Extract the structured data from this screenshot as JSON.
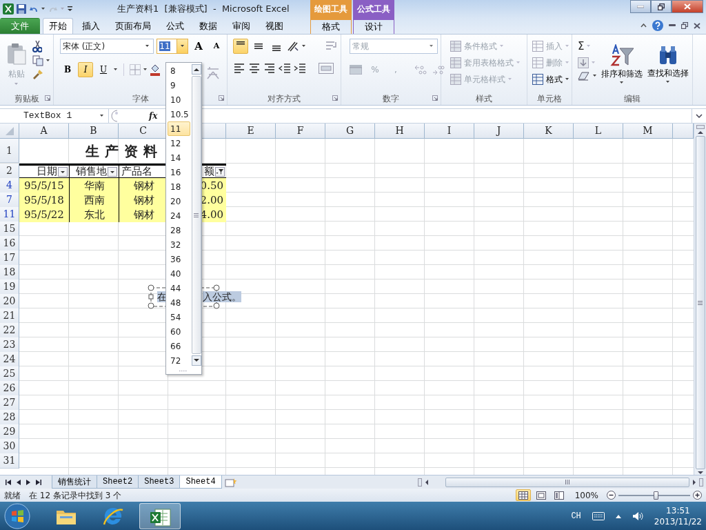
{
  "title_bar": {
    "title": "生产资料1  [兼容模式]  -  Microsoft Excel",
    "context_tabs": [
      {
        "label": "绘图工具",
        "color": "#e59a3c"
      },
      {
        "label": "公式工具",
        "color": "#8a5fc4"
      }
    ]
  },
  "tabs": [
    {
      "label": "文件",
      "kind": "file",
      "selected": false
    },
    {
      "label": "开始",
      "kind": "normal",
      "selected": true
    },
    {
      "label": "插入",
      "kind": "normal",
      "selected": false
    },
    {
      "label": "页面布局",
      "kind": "normal",
      "selected": false
    },
    {
      "label": "公式",
      "kind": "normal",
      "selected": false
    },
    {
      "label": "数据",
      "kind": "normal",
      "selected": false
    },
    {
      "label": "审阅",
      "kind": "normal",
      "selected": false
    },
    {
      "label": "视图",
      "kind": "normal",
      "selected": false
    },
    {
      "label": "格式",
      "kind": "context",
      "color": "#e59a3c",
      "selected": false
    },
    {
      "label": "设计",
      "kind": "context",
      "color": "#8a5fc4",
      "selected": false
    }
  ],
  "ribbon": {
    "clipboard": {
      "paste": "粘贴",
      "label": "剪贴板"
    },
    "font": {
      "name": "宋体 (正文)",
      "size": "11",
      "grow": "A",
      "shrink": "A",
      "bold": {
        "text": "B",
        "on": false
      },
      "italic": {
        "text": "I",
        "on": true
      },
      "underline": {
        "text": "U",
        "on": false
      },
      "label": "字体"
    },
    "alignment": {
      "vertical": [
        {
          "kind": "top",
          "selected": true
        },
        {
          "kind": "middle",
          "selected": false
        },
        {
          "kind": "bottom",
          "selected": false
        }
      ],
      "label": "对齐方式"
    },
    "number": {
      "format": "常规",
      "percent": "%",
      "comma": ",",
      "label": "数字"
    },
    "styles": {
      "items": [
        "条件格式",
        "套用表格格式",
        "单元格样式"
      ],
      "label": "样式"
    },
    "cells": {
      "items": [
        {
          "label": "插入",
          "disabled": true
        },
        {
          "label": "删除",
          "disabled": true
        },
        {
          "label": "格式",
          "disabled": false
        }
      ],
      "label": "单元格"
    },
    "editing": {
      "sum": "Σ",
      "sort": "排序和筛选",
      "find": "查找和选择",
      "label": "编辑"
    }
  },
  "formula_bar": {
    "name_box": "TextBox 1",
    "fx": "fx"
  },
  "sheet": {
    "columns": [
      {
        "label": "A",
        "kind": "normal"
      },
      {
        "label": "B",
        "kind": "normal"
      },
      {
        "label": "C",
        "kind": "normal"
      },
      {
        "kind": "covered"
      },
      {
        "label": "E",
        "kind": "normal"
      },
      {
        "label": "F",
        "kind": "normal"
      },
      {
        "label": "G",
        "kind": "normal"
      },
      {
        "label": "H",
        "kind": "normal"
      },
      {
        "label": "I",
        "kind": "normal"
      },
      {
        "label": "J",
        "kind": "normal"
      },
      {
        "label": "K",
        "kind": "normal"
      },
      {
        "label": "L",
        "kind": "normal"
      },
      {
        "label": "M",
        "kind": "normal"
      }
    ],
    "rows": [
      {
        "number": "1",
        "kind": "title",
        "filtered": false,
        "title": "生产资料"
      },
      {
        "number": "2",
        "kind": "header",
        "filtered": false,
        "cells": [
          {
            "text": "日期",
            "has_filter": true,
            "filter_applied": false
          },
          {
            "text": "销售地",
            "has_filter": true,
            "filter_applied": false
          },
          {
            "text": "产品名",
            "has_filter": false
          },
          {
            "text": "额",
            "has_filter": true,
            "filter_applied": true
          }
        ]
      },
      {
        "number": "4",
        "kind": "data",
        "filtered": true,
        "cells": [
          "95/5/15",
          "华南",
          "钢材",
          "0.50"
        ]
      },
      {
        "number": "7",
        "kind": "data",
        "filtered": true,
        "cells": [
          "95/5/18",
          "西南",
          "钢材",
          "2.00"
        ]
      },
      {
        "number": "11",
        "kind": "data",
        "filtered": true,
        "cells": [
          "95/5/22",
          "东北",
          "钢材",
          "4.00"
        ]
      },
      {
        "number": "15",
        "kind": "empty",
        "filtered": false
      },
      {
        "number": "16",
        "kind": "empty",
        "filtered": false
      },
      {
        "number": "17",
        "kind": "empty",
        "filtered": false
      },
      {
        "number": "18",
        "kind": "empty",
        "filtered": false
      },
      {
        "number": "19",
        "kind": "empty",
        "filtered": false
      },
      {
        "number": "20",
        "kind": "empty",
        "filtered": false
      },
      {
        "number": "21",
        "kind": "empty",
        "filtered": false
      },
      {
        "number": "22",
        "kind": "empty",
        "filtered": false
      },
      {
        "number": "23",
        "kind": "empty",
        "filtered": false
      },
      {
        "number": "24",
        "kind": "empty",
        "filtered": false
      },
      {
        "number": "25",
        "kind": "empty",
        "filtered": false
      },
      {
        "number": "26",
        "kind": "empty",
        "filtered": false
      },
      {
        "number": "27",
        "kind": "empty",
        "filtered": false
      },
      {
        "number": "28",
        "kind": "empty",
        "filtered": false
      },
      {
        "number": "29",
        "kind": "empty",
        "filtered": false
      },
      {
        "number": "30",
        "kind": "empty",
        "filtered": false
      },
      {
        "number": "31",
        "kind": "empty",
        "filtered": false
      }
    ]
  },
  "textbox": {
    "parts": [
      "在",
      "入公式。"
    ]
  },
  "size_dropdown": {
    "sizes": [
      {
        "label": "8",
        "selected": false
      },
      {
        "label": "9",
        "selected": false
      },
      {
        "label": "10",
        "selected": false
      },
      {
        "label": "10.5",
        "selected": false
      },
      {
        "label": "11",
        "selected": true
      },
      {
        "label": "12",
        "selected": false
      },
      {
        "label": "14",
        "selected": false
      },
      {
        "label": "16",
        "selected": false
      },
      {
        "label": "18",
        "selected": false
      },
      {
        "label": "20",
        "selected": false
      },
      {
        "label": "24",
        "selected": false
      },
      {
        "label": "28",
        "selected": false
      },
      {
        "label": "32",
        "selected": false
      },
      {
        "label": "36",
        "selected": false
      },
      {
        "label": "40",
        "selected": false
      },
      {
        "label": "44",
        "selected": false
      },
      {
        "label": "48",
        "selected": false
      },
      {
        "label": "54",
        "selected": false
      },
      {
        "label": "60",
        "selected": false
      },
      {
        "label": "66",
        "selected": false
      },
      {
        "label": "72",
        "selected": false
      }
    ]
  },
  "sheet_tabs": [
    {
      "label": "销售统计",
      "selected": false
    },
    {
      "label": "Sheet2",
      "selected": false
    },
    {
      "label": "Sheet3",
      "selected": false
    },
    {
      "label": "Sheet4",
      "selected": true
    }
  ],
  "status_bar": {
    "mode": "就绪",
    "message": "在 12 条记录中找到 3 个",
    "views": [
      {
        "kind": "normal",
        "selected": true
      },
      {
        "kind": "layout",
        "selected": false
      },
      {
        "kind": "pagebreak",
        "selected": false
      }
    ],
    "zoom": "100%",
    "zoom_slider": {
      "level": 0.53
    }
  },
  "taskbar": {
    "apps": [
      {
        "kind": "explorer",
        "selected": false
      },
      {
        "kind": "browser",
        "selected": false
      },
      {
        "kind": "excel",
        "selected": true
      }
    ],
    "language": "CH",
    "time": "13:51",
    "date": "2013/11/22"
  }
}
